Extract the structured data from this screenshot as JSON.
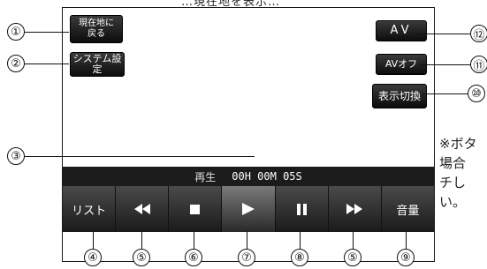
{
  "partial_title": "…現在地を表示…",
  "left_buttons": {
    "home": "現在地に\n戻る",
    "system": "システム設定"
  },
  "right_buttons": {
    "av": "AV",
    "av_off": "AVオフ",
    "display_switch": "表示切換"
  },
  "status": {
    "state": "再生",
    "time": "00H 00M 05S"
  },
  "controls": {
    "list": "リスト",
    "volume": "音量"
  },
  "icons": {
    "rewind": "rewind-icon",
    "stop": "stop-icon",
    "play": "play-icon",
    "pause": "pause-icon",
    "fast_forward": "fast-forward-icon"
  },
  "callouts": {
    "c1": "①",
    "c2": "②",
    "c3": "③",
    "c4": "④",
    "c5a": "⑤",
    "c6": "⑥",
    "c7": "⑦",
    "c8": "⑧",
    "c5b": "⑤",
    "c9": "⑨",
    "c10": "⑩",
    "c11": "⑪",
    "c12": "⑫"
  },
  "note_text": "※ボタ\n場合\nチし\nい。"
}
